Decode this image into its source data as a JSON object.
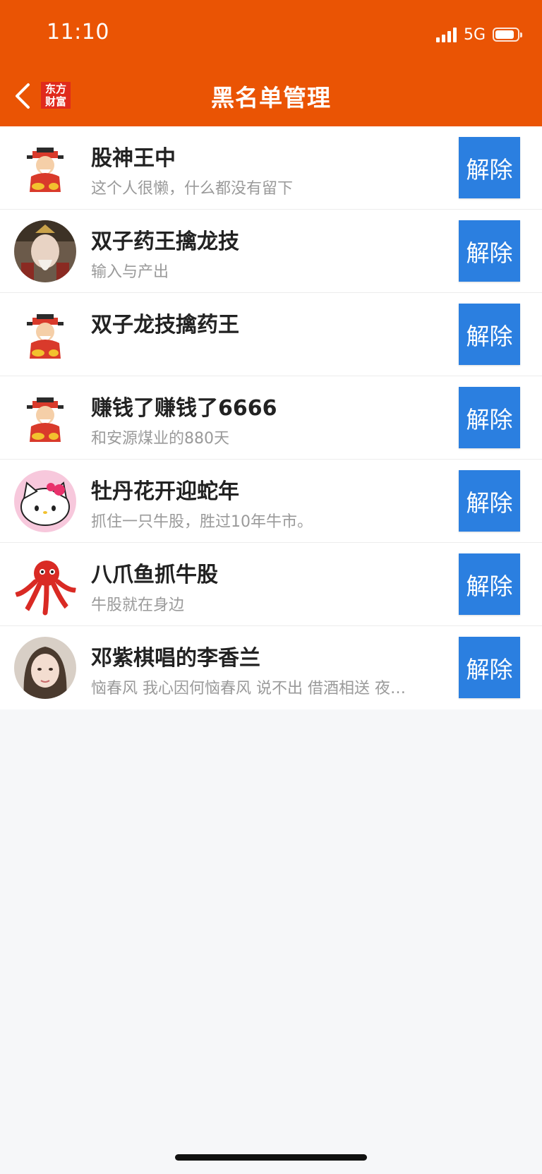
{
  "colors": {
    "accent": "#ea5404",
    "button": "#2b7fe0"
  },
  "status_bar": {
    "time": "11:10",
    "network": "5G",
    "battery_level": 0.85
  },
  "nav": {
    "logo": [
      "东方",
      "财富"
    ],
    "title": "黑名单管理",
    "back_icon": "chevron-left-icon"
  },
  "users": [
    {
      "name": "股神王中",
      "desc": "这个人很懒，什么都没有留下",
      "avatar": "god-of-wealth-avatar",
      "button": "解除"
    },
    {
      "name": "双子药王擒龙技",
      "desc": "输入与产出",
      "avatar": "photo-avatar",
      "button": "解除"
    },
    {
      "name": "双子龙技擒药王",
      "desc": "",
      "avatar": "god-of-wealth-avatar",
      "button": "解除"
    },
    {
      "name": "赚钱了赚钱了6666",
      "desc": "和安源煤业的880天",
      "avatar": "god-of-wealth-avatar",
      "button": "解除"
    },
    {
      "name": "牡丹花开迎蛇年",
      "desc": "抓住一只牛股，胜过10年牛市。",
      "avatar": "hello-kitty-avatar",
      "button": "解除"
    },
    {
      "name": "八爪鱼抓牛股",
      "desc": "牛股就在身边",
      "avatar": "octopus-avatar",
      "button": "解除"
    },
    {
      "name": "邓紫棋唱的李香兰",
      "desc": "恼春风 我心因何恼春风 说不出 借酒相送 夜…",
      "avatar": "portrait-avatar",
      "button": "解除"
    }
  ]
}
